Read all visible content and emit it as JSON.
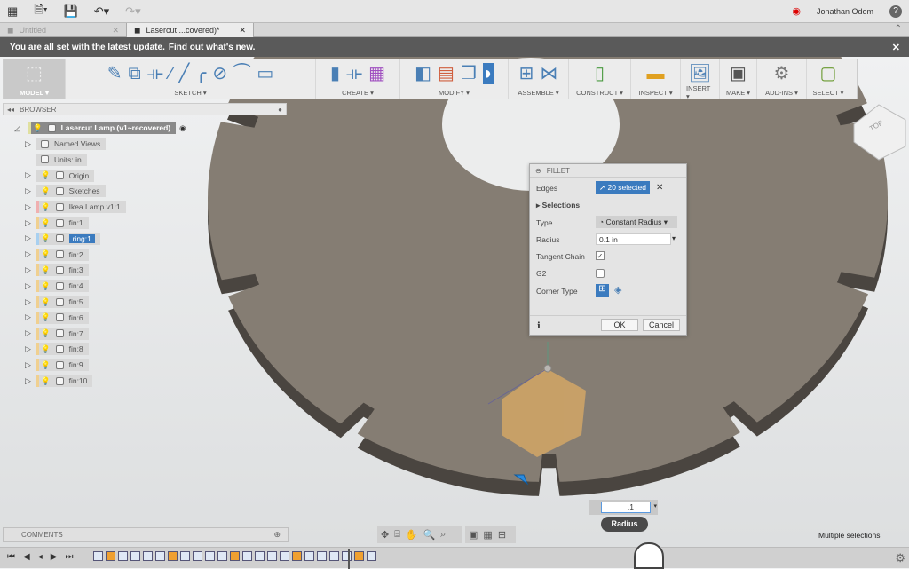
{
  "topbar": {
    "user": "Jonathan Odom",
    "help": "?"
  },
  "tabs": [
    {
      "label": "Untitled"
    },
    {
      "label": "Lasercut ...covered)*"
    }
  ],
  "banner": {
    "text": "You are all set with the latest update.",
    "link": "Find out what's new."
  },
  "toolbar": {
    "groups": [
      {
        "label": "MODEL ▾"
      },
      {
        "label": "SKETCH ▾"
      },
      {
        "label": "CREATE ▾"
      },
      {
        "label": "MODIFY ▾"
      },
      {
        "label": "ASSEMBLE ▾"
      },
      {
        "label": "CONSTRUCT ▾"
      },
      {
        "label": "INSPECT ▾"
      },
      {
        "label": "INSERT ▾"
      },
      {
        "label": "MAKE ▾"
      },
      {
        "label": "ADD-INS ▾"
      },
      {
        "label": "SELECT ▾"
      }
    ]
  },
  "browser": {
    "title": "BROWSER",
    "root": "Lasercut Lamp (v1~recovered)",
    "items": [
      {
        "label": "Named Views"
      },
      {
        "label": "Units: in"
      },
      {
        "label": "Origin"
      },
      {
        "label": "Sketches"
      },
      {
        "label": "Ikea Lamp v1:1"
      },
      {
        "label": "fin:1"
      },
      {
        "label": "ring:1"
      },
      {
        "label": "fin:2"
      },
      {
        "label": "fin:3"
      },
      {
        "label": "fin:4"
      },
      {
        "label": "fin:5"
      },
      {
        "label": "fin:6"
      },
      {
        "label": "fin:7"
      },
      {
        "label": "fin:8"
      },
      {
        "label": "fin:9"
      },
      {
        "label": "fin:10"
      }
    ]
  },
  "fillet": {
    "title": "FILLET",
    "edges_label": "Edges",
    "edges_value": "20 selected",
    "selections": "Selections",
    "type_label": "Type",
    "type_value": "Constant Radius",
    "radius_label": "Radius",
    "radius_value": "0.1 in",
    "tangent_label": "Tangent Chain",
    "tangent_checked": true,
    "g2_label": "G2",
    "g2_checked": false,
    "corner_label": "Corner Type",
    "ok": "OK",
    "cancel": "Cancel"
  },
  "input_box": {
    "value": ".1",
    "tooltip": "Radius"
  },
  "viewcube": {
    "face": "TOP"
  },
  "comments": {
    "title": "COMMENTS"
  },
  "status": {
    "text": "Multiple selections"
  },
  "colors": {
    "accent": "#3b7bbf",
    "banner": "#5a5a5a",
    "part_top": "#857d73",
    "part_side": "#4a4540"
  }
}
